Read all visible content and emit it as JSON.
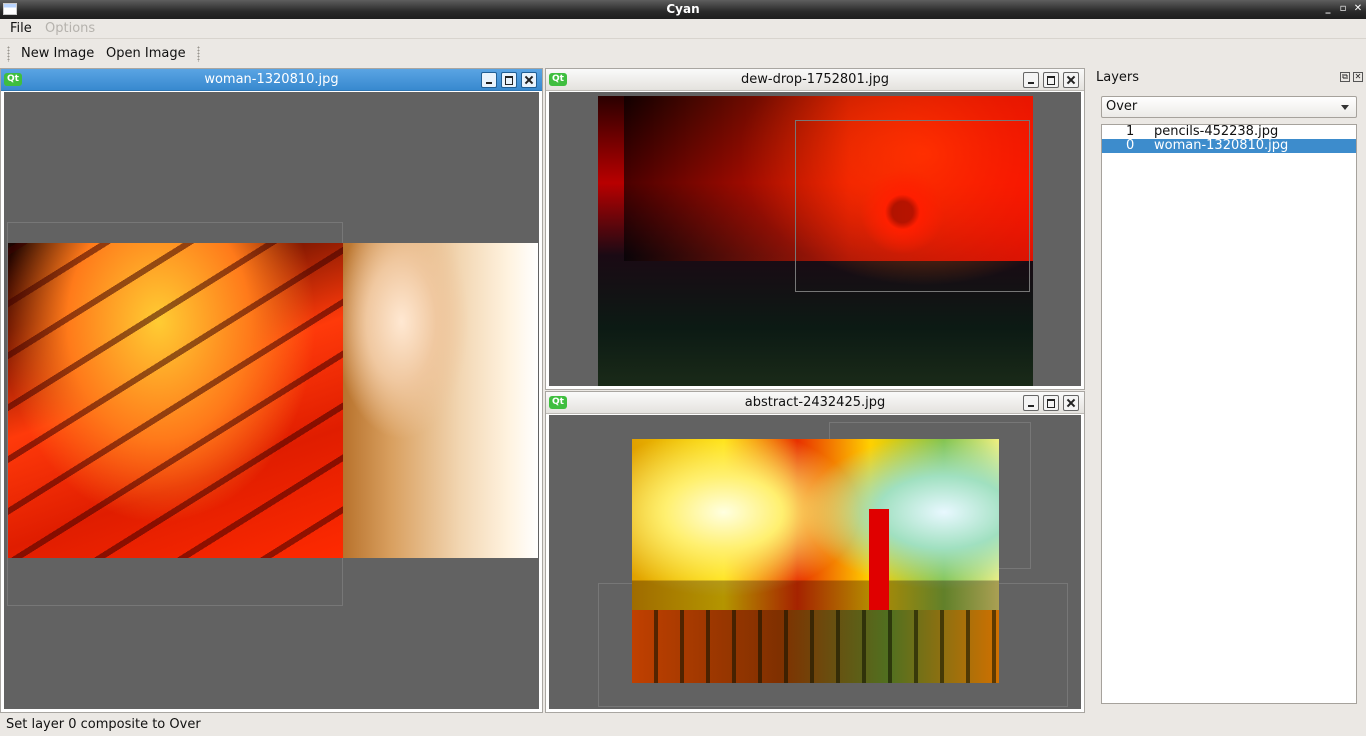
{
  "window": {
    "title": "Cyan"
  },
  "menu": {
    "file": "File",
    "options": "Options"
  },
  "toolbar": {
    "new_image": "New Image",
    "open_image": "Open Image"
  },
  "subwindows": [
    {
      "title": "woman-1320810.jpg",
      "badge": "Qt",
      "active": true
    },
    {
      "title": "dew-drop-1752801.jpg",
      "badge": "Qt",
      "active": false
    },
    {
      "title": "abstract-2432425.jpg",
      "badge": "Qt",
      "active": false
    }
  ],
  "layers_panel": {
    "title": "Layers",
    "composite_mode": "Over",
    "layers": [
      {
        "index": "1",
        "name": "pencils-452238.jpg",
        "selected": false
      },
      {
        "index": "0",
        "name": "woman-1320810.jpg",
        "selected": true
      }
    ]
  },
  "status": {
    "message": "Set layer 0 composite to Over"
  },
  "colors": {
    "active_title": "#3889cf",
    "canvas_bg": "#626262",
    "selection": "#3d8ccc",
    "qt_badge": "#3fbe3f"
  }
}
